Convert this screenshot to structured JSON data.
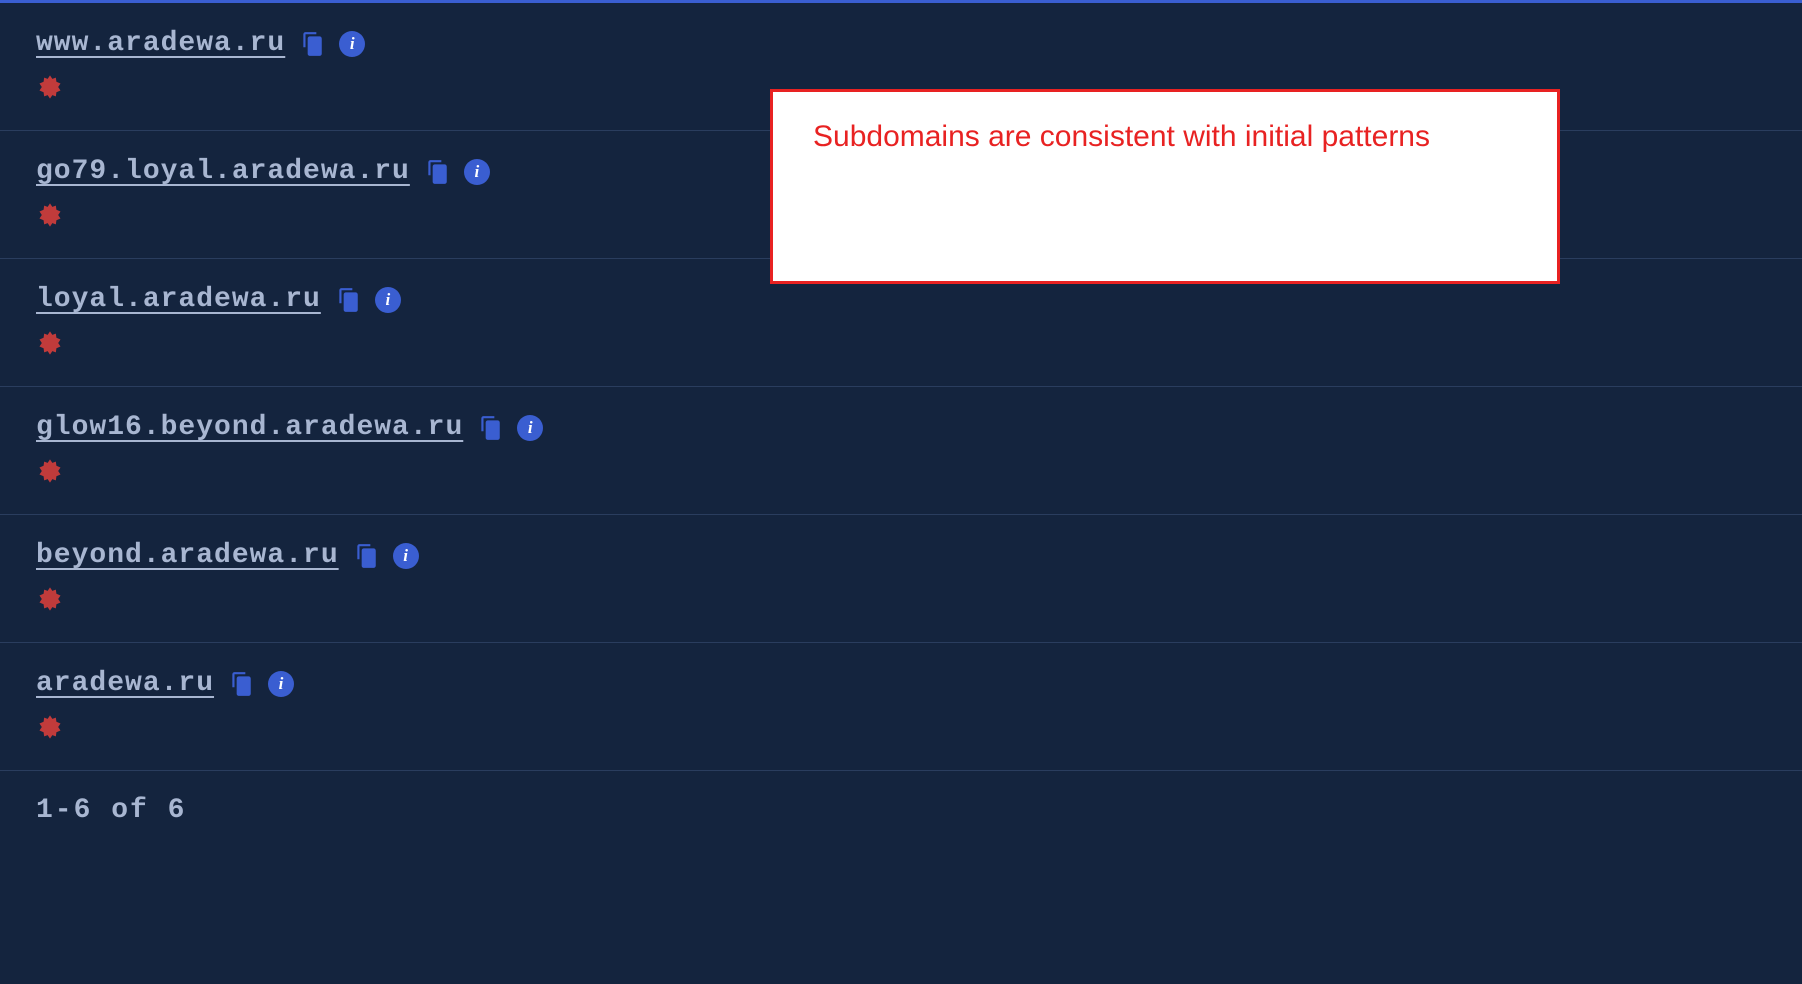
{
  "rows": [
    {
      "domain": "www.aradewa.ru"
    },
    {
      "domain": "go79.loyal.aradewa.ru"
    },
    {
      "domain": "loyal.aradewa.ru"
    },
    {
      "domain": "glow16.beyond.aradewa.ru"
    },
    {
      "domain": "beyond.aradewa.ru"
    },
    {
      "domain": "aradewa.ru"
    }
  ],
  "pagination": "1-6 of 6",
  "annotation": {
    "text": "Subdomains are consistent with initial patterns"
  },
  "icons": {
    "copy": "copy-icon",
    "info": "info-icon",
    "threat": "threat-icon"
  }
}
